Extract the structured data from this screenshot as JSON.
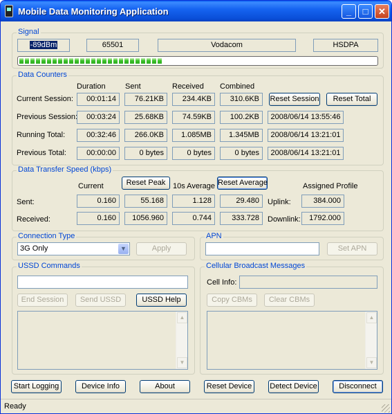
{
  "window": {
    "title": "Mobile Data Monitoring Application"
  },
  "signal": {
    "label": "Signal",
    "strength": "-89dBm",
    "code": "65501",
    "operator": "Vodacom",
    "network": "HSDPA",
    "level_percent": 40
  },
  "counters": {
    "label": "Data Counters",
    "headers": [
      "Duration",
      "Sent",
      "Received",
      "Combined"
    ],
    "rows": [
      {
        "label": "Current Session:",
        "duration": "00:01:14",
        "sent": "76.21KB",
        "received": "234.4KB",
        "combined": "310.6KB"
      },
      {
        "label": "Previous Session:",
        "duration": "00:03:24",
        "sent": "25.68KB",
        "received": "74.59KB",
        "combined": "100.2KB",
        "timestamp": "2008/06/14 13:55:46"
      },
      {
        "label": "Running Total:",
        "duration": "00:32:46",
        "sent": "266.0KB",
        "received": "1.085MB",
        "combined": "1.345MB",
        "timestamp": "2008/06/14 13:21:01"
      },
      {
        "label": "Previous Total:",
        "duration": "00:00:00",
        "sent": "0 bytes",
        "received": "0 bytes",
        "combined": "0 bytes",
        "timestamp": "2008/06/14 13:21:01"
      }
    ],
    "reset_session": "Reset Session",
    "reset_total": "Reset Total"
  },
  "speed": {
    "label": "Data Transfer Speed (kbps)",
    "col_current": "Current",
    "reset_peak": "Reset Peak",
    "col_avg": "10s Average",
    "reset_average": "Reset Average",
    "assigned_profile": "Assigned Profile",
    "sent": {
      "label": "Sent:",
      "current": "0.160",
      "peak": "55.168",
      "avg10": "1.128",
      "average": "29.480",
      "profile_label": "Uplink:",
      "profile": "384.000"
    },
    "received": {
      "label": "Received:",
      "current": "0.160",
      "peak": "1056.960",
      "avg10": "0.744",
      "average": "333.728",
      "profile_label": "Downlink:",
      "profile": "1792.000"
    }
  },
  "connection": {
    "label": "Connection Type",
    "selected": "3G Only",
    "apply": "Apply"
  },
  "apn": {
    "label": "APN",
    "value": "",
    "set": "Set APN"
  },
  "ussd": {
    "label": "USSD Commands",
    "value": "",
    "end": "End Session",
    "send": "Send USSD",
    "help": "USSD Help"
  },
  "cbm": {
    "label": "Cellular Broadcast Messages",
    "cell_info_label": "Cell Info:",
    "cell_info": "",
    "copy": "Copy CBMs",
    "clear": "Clear CBMs"
  },
  "footer": {
    "start_logging": "Start Logging",
    "device_info": "Device Info",
    "about": "About",
    "reset_device": "Reset Device",
    "detect_device": "Detect Device",
    "disconnect": "Disconnect"
  },
  "status": {
    "text": "Ready"
  }
}
